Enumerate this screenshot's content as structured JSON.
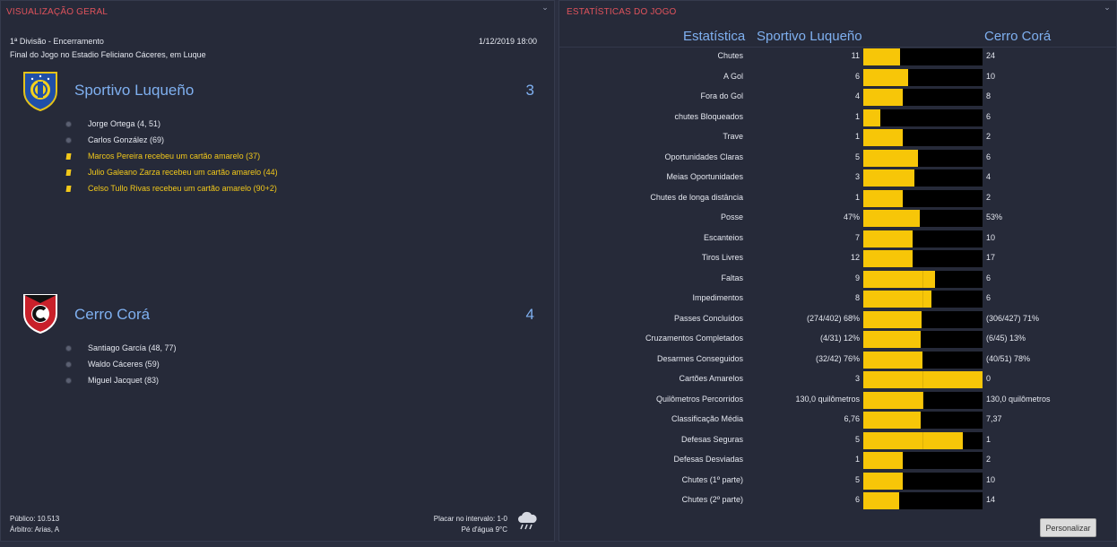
{
  "overview": {
    "title": "VISUALIZAÇÃO GERAL",
    "competition": "1ª Divisão - Encerramento",
    "venue": "Final do Jogo no Estadio Feliciano Cáceres, em Luque",
    "datetime": "1/12/2019 18:00",
    "home": {
      "name": "Sportivo Luqueño",
      "score": "3",
      "events": [
        {
          "type": "goal",
          "icon": "ball-icon",
          "text": "Jorge Ortega (4, 51)"
        },
        {
          "type": "goal",
          "icon": "ball-icon",
          "text": "Carlos González (69)"
        },
        {
          "type": "yellow",
          "icon": "yellow-card-icon",
          "text": "Marcos Pereira recebeu um cartão amarelo (37)"
        },
        {
          "type": "yellow",
          "icon": "yellow-card-icon",
          "text": "Julio Galeano Zarza recebeu um cartão amarelo (44)"
        },
        {
          "type": "yellow",
          "icon": "yellow-card-icon",
          "text": "Celso Tullo Rivas recebeu um cartão amarelo (90+2)"
        }
      ]
    },
    "away": {
      "name": "Cerro Corá",
      "score": "4",
      "events": [
        {
          "type": "goal",
          "icon": "ball-icon",
          "text": "Santiago García (48, 77)"
        },
        {
          "type": "goal",
          "icon": "ball-icon",
          "text": "Waldo Cáceres (59)"
        },
        {
          "type": "goal",
          "icon": "ball-icon",
          "text": "Miguel Jacquet (83)"
        }
      ]
    },
    "attendance": "Público: 10.513",
    "referee": "Árbitro: Arias, A",
    "halftime": "Placar no intervalo: 1-0",
    "weather_text": "Pé d'água 9°C",
    "weather_icon": "rain-cloud-icon"
  },
  "stats": {
    "title": "ESTATÍSTICAS DO JOGO",
    "col_stat": "Estatística",
    "col_home": "Sportivo Luqueño",
    "col_away": "Cerro Corá",
    "home_color": "#f7c608",
    "away_color": "#000000",
    "rows": [
      {
        "label": "Chutes",
        "home": "11",
        "away": "24",
        "home_share": 0.31
      },
      {
        "label": "A Gol",
        "home": "6",
        "away": "10",
        "home_share": 0.375
      },
      {
        "label": "Fora do Gol",
        "home": "4",
        "away": "8",
        "home_share": 0.333
      },
      {
        "label": "chutes Bloqueados",
        "home": "1",
        "away": "6",
        "home_share": 0.143
      },
      {
        "label": "Trave",
        "home": "1",
        "away": "2",
        "home_share": 0.333
      },
      {
        "label": "Oportunidades Claras",
        "home": "5",
        "away": "6",
        "home_share": 0.455
      },
      {
        "label": "Meias Oportunidades",
        "home": "3",
        "away": "4",
        "home_share": 0.429
      },
      {
        "label": "Chutes de longa distância",
        "home": "1",
        "away": "2",
        "home_share": 0.333
      },
      {
        "label": "Posse",
        "home": "47%",
        "away": "53%",
        "home_share": 0.47
      },
      {
        "label": "Escanteios",
        "home": "7",
        "away": "10",
        "home_share": 0.412
      },
      {
        "label": "Tiros Livres",
        "home": "12",
        "away": "17",
        "home_share": 0.414
      },
      {
        "label": "Faltas",
        "home": "9",
        "away": "6",
        "home_share": 0.6
      },
      {
        "label": "Impedimentos",
        "home": "8",
        "away": "6",
        "home_share": 0.571
      },
      {
        "label": "Passes Concluídos",
        "home": "(274/402) 68%",
        "away": "(306/427) 71%",
        "home_share": 0.489
      },
      {
        "label": "Cruzamentos Completados",
        "home": "(4/31) 12%",
        "away": "(6/45) 13%",
        "home_share": 0.48
      },
      {
        "label": "Desarmes Conseguidos",
        "home": "(32/42) 76%",
        "away": "(40/51) 78%",
        "home_share": 0.494
      },
      {
        "label": "Cartões Amarelos",
        "home": "3",
        "away": "0",
        "home_share": 1.0
      },
      {
        "label": "Quilômetros Percorridos",
        "home": "130,0 quilômetros",
        "away": "130,0 quilômetros",
        "home_share": 0.5
      },
      {
        "label": "Classificação Média",
        "home": "6,76",
        "away": "7,37",
        "home_share": 0.478
      },
      {
        "label": "Defesas Seguras",
        "home": "5",
        "away": "1",
        "home_share": 0.833
      },
      {
        "label": "Defesas Desviadas",
        "home": "1",
        "away": "2",
        "home_share": 0.333
      },
      {
        "label": "Chutes (1º parte)",
        "home": "5",
        "away": "10",
        "home_share": 0.333
      },
      {
        "label": "Chutes (2º parte)",
        "home": "6",
        "away": "14",
        "home_share": 0.3
      }
    ],
    "customize_label": "Personalizar"
  }
}
